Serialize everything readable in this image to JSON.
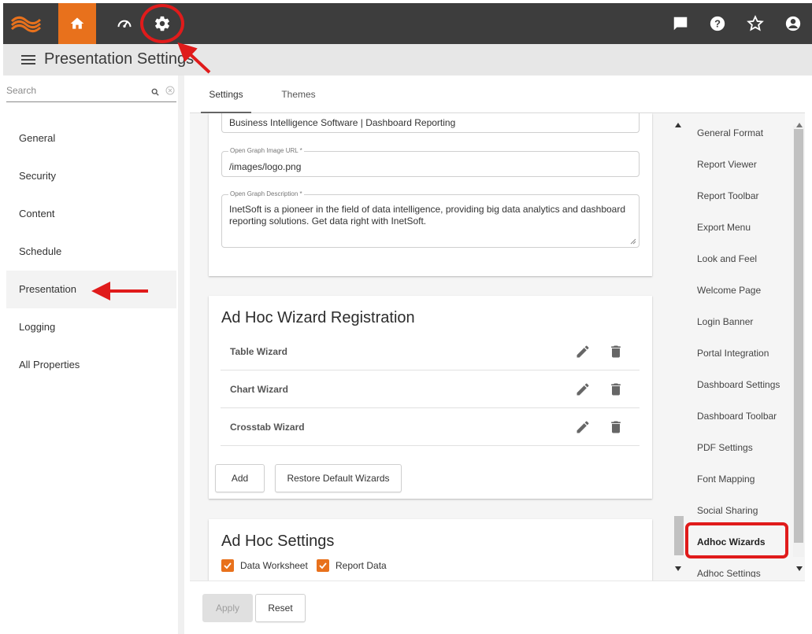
{
  "topbar": {
    "icons": [
      "logo-icon",
      "home-icon",
      "dashboard-gauge-icon",
      "settings-gear-icon",
      "chat-icon",
      "help-icon",
      "star-icon",
      "account-icon"
    ],
    "accent_color": "#e8711c"
  },
  "header": {
    "title": "Presentation Settings"
  },
  "sidebar": {
    "search_placeholder": "Search",
    "items": [
      {
        "label": "General"
      },
      {
        "label": "Security"
      },
      {
        "label": "Content"
      },
      {
        "label": "Schedule"
      },
      {
        "label": "Presentation"
      },
      {
        "label": "Logging"
      },
      {
        "label": "All Properties"
      }
    ],
    "active_item": "Presentation"
  },
  "tabs": [
    {
      "label": "Settings"
    },
    {
      "label": "Themes"
    }
  ],
  "social": {
    "title_value": "Business Intelligence Software | Dashboard Reporting",
    "image_url_label": "Open Graph Image URL *",
    "image_url_value": "/images/logo.png",
    "description_label": "Open Graph Description *",
    "description_value": "InetSoft is a pioneer in the field of data intelligence, providing big data analytics and dashboard reporting solutions. Get data right with InetSoft."
  },
  "wizards": {
    "title": "Ad Hoc Wizard Registration",
    "rows": [
      {
        "label": "Table Wizard"
      },
      {
        "label": "Chart Wizard"
      },
      {
        "label": "Crosstab Wizard"
      }
    ],
    "add_label": "Add",
    "restore_label": "Restore Default Wizards"
  },
  "adhoc": {
    "title": "Ad Hoc Settings",
    "options": [
      {
        "label": "Data Worksheet",
        "checked": true
      },
      {
        "label": "Report Data",
        "checked": true
      }
    ]
  },
  "footer": {
    "apply_label": "Apply",
    "reset_label": "Reset"
  },
  "right_nav": {
    "items": [
      {
        "label": "General Format"
      },
      {
        "label": "Report Viewer"
      },
      {
        "label": "Report Toolbar"
      },
      {
        "label": "Export Menu"
      },
      {
        "label": "Look and Feel"
      },
      {
        "label": "Welcome Page"
      },
      {
        "label": "Login Banner"
      },
      {
        "label": "Portal Integration"
      },
      {
        "label": "Dashboard Settings"
      },
      {
        "label": "Dashboard Toolbar"
      },
      {
        "label": "PDF Settings"
      },
      {
        "label": "Font Mapping"
      },
      {
        "label": "Social Sharing"
      },
      {
        "label": "Adhoc Wizards"
      },
      {
        "label": "Adhoc Settings"
      }
    ],
    "active_item": "Adhoc Wizards"
  },
  "annotation_color": "#e01b1b"
}
